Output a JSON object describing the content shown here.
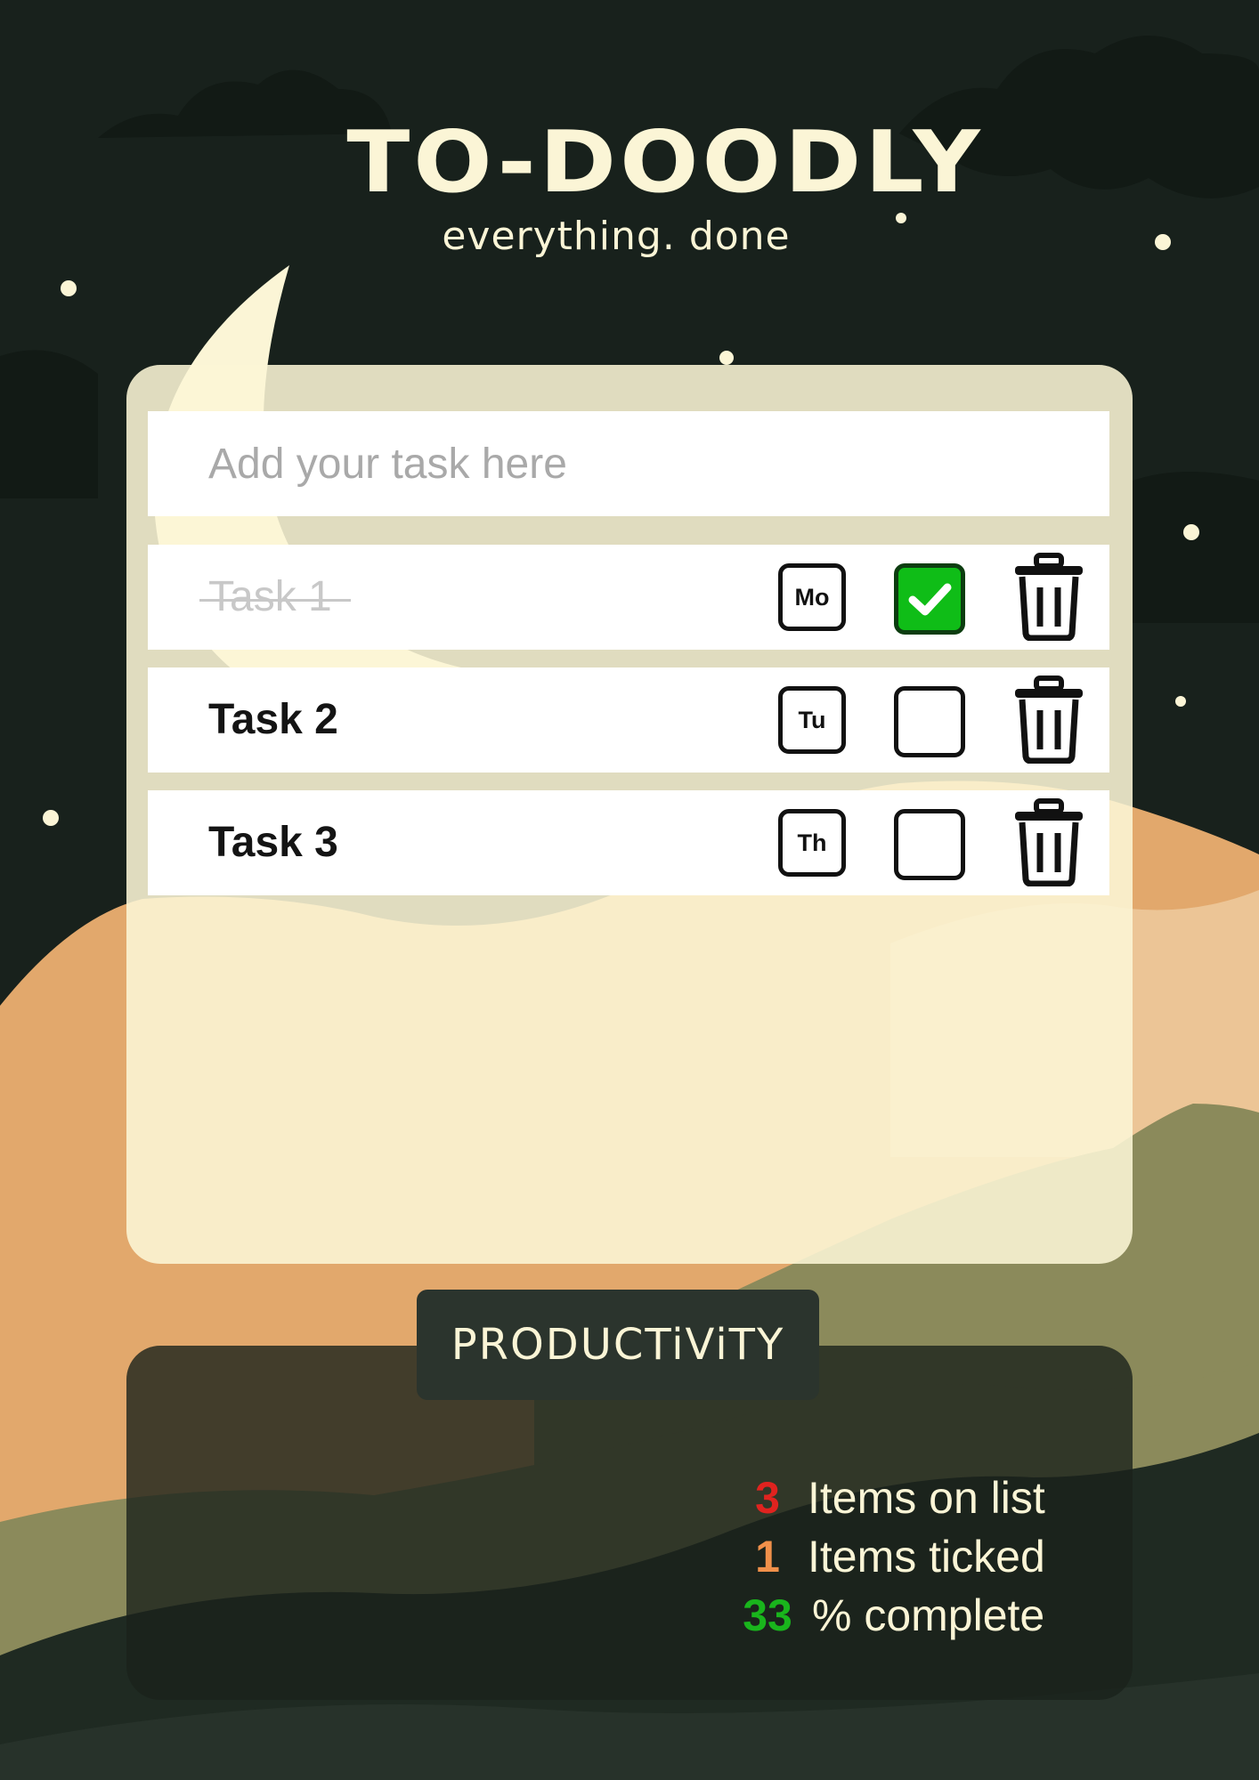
{
  "app": {
    "title": "TO-DOODLY",
    "subtitle": "everything. done"
  },
  "input": {
    "placeholder": "Add your task here",
    "value": ""
  },
  "tasks": [
    {
      "label": "Task 1",
      "day": "Mo",
      "checked": true
    },
    {
      "label": "Task 2",
      "day": "Tu",
      "checked": false
    },
    {
      "label": "Task 3",
      "day": "Th",
      "checked": false
    }
  ],
  "productivity": {
    "heading": "PRODUCTiViTY",
    "items_count": "3",
    "items_label": "Items on list",
    "ticked_count": "1",
    "ticked_label": "Items ticked",
    "percent": "33",
    "percent_label": "% complete"
  },
  "colors": {
    "checked_green": "#0fbd17",
    "count_red": "#e0231f",
    "ticked_orange": "#f0904a",
    "percent_green": "#19b51c",
    "cream": "#fbf5d6",
    "night": "#18211c"
  },
  "icons": [
    "checkmark-icon",
    "trash-icon",
    "moon-icon",
    "star-icon",
    "cloud-icon"
  ]
}
